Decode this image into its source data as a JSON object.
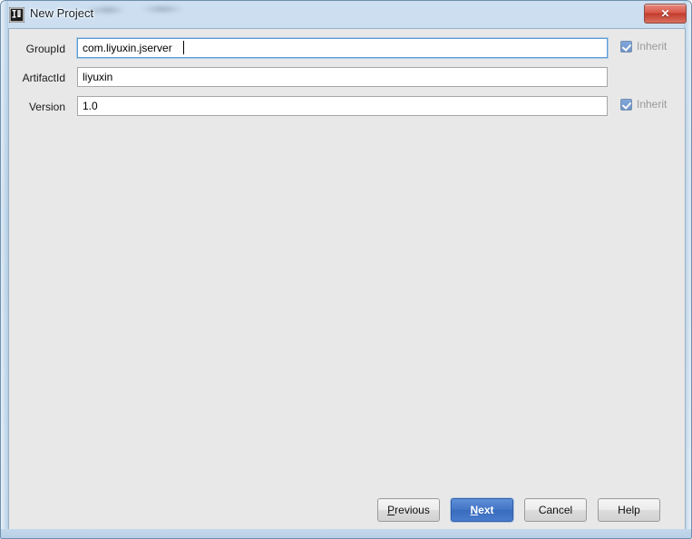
{
  "window": {
    "title": "New Project",
    "app_icon": "intellij-idea-icon",
    "close_label": "✕",
    "frame_color": "#bed5ea",
    "client_background": "#e8e8e8"
  },
  "form": {
    "rows": [
      {
        "label": "GroupId",
        "value": "com.liyuxin.jserver",
        "placeholder": "",
        "focused": true,
        "has_inherit": true,
        "inherit_label": "Inherit",
        "inherit_checked": true
      },
      {
        "label": "ArtifactId",
        "value": "liyuxin",
        "placeholder": "",
        "focused": false,
        "has_inherit": false,
        "inherit_label": "",
        "inherit_checked": false
      },
      {
        "label": "Version",
        "value": "1.0",
        "placeholder": "",
        "focused": false,
        "has_inherit": true,
        "inherit_label": "Inherit",
        "inherit_checked": true
      }
    ]
  },
  "buttons": {
    "previous": {
      "prefix": "",
      "mnemonic": "P",
      "suffix": "revious"
    },
    "next": {
      "prefix": "",
      "mnemonic": "N",
      "suffix": "ext"
    },
    "cancel": {
      "label": "Cancel"
    },
    "help": {
      "label": "Help"
    }
  },
  "colors": {
    "accent_blue": "#4274c4",
    "checkbox_blue": "#3f72bd",
    "close_red": "#c23b2c",
    "focus_border": "#5b9bd5"
  }
}
